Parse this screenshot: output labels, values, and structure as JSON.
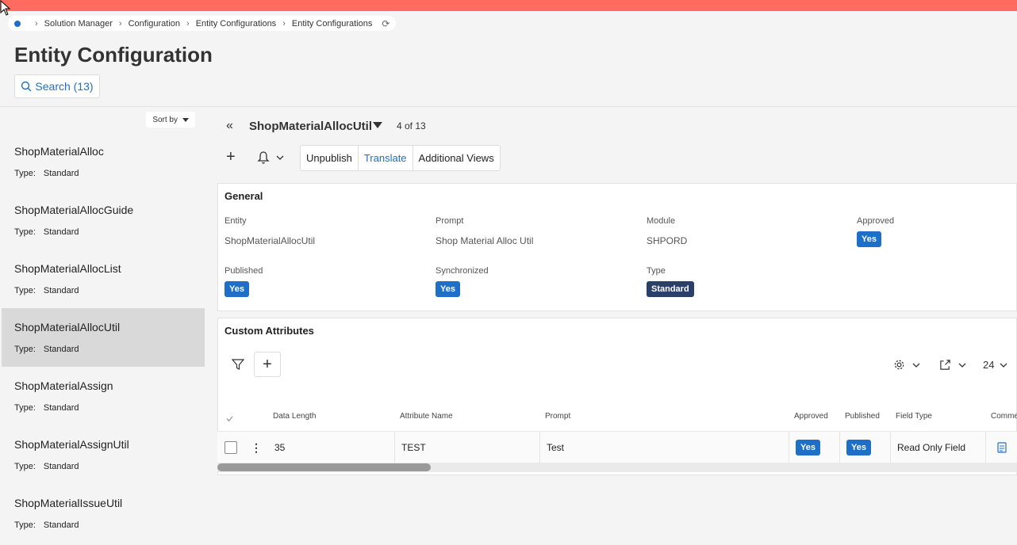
{
  "breadcrumb": {
    "items": [
      "Solution Manager",
      "Configuration",
      "Entity Configurations",
      "Entity Configurations"
    ]
  },
  "page": {
    "title": "Entity Configuration",
    "search_label": "Search (13)"
  },
  "sidebar": {
    "sort_label": "Sort by",
    "type_label": "Type:",
    "items": [
      {
        "name": "ShopMaterialAlloc",
        "type": "Standard"
      },
      {
        "name": "ShopMaterialAllocGuide",
        "type": "Standard"
      },
      {
        "name": "ShopMaterialAllocList",
        "type": "Standard"
      },
      {
        "name": "ShopMaterialAllocUtil",
        "type": "Standard"
      },
      {
        "name": "ShopMaterialAssign",
        "type": "Standard"
      },
      {
        "name": "ShopMaterialAssignUtil",
        "type": "Standard"
      },
      {
        "name": "ShopMaterialIssueUtil",
        "type": "Standard"
      }
    ]
  },
  "record": {
    "title": "ShopMaterialAllocUtil",
    "count": "4 of 13"
  },
  "toolbar": {
    "unpublish": "Unpublish",
    "translate": "Translate",
    "additional_views": "Additional Views"
  },
  "general": {
    "title": "General",
    "entity_label": "Entity",
    "entity_value": "ShopMaterialAllocUtil",
    "prompt_label": "Prompt",
    "prompt_value": "Shop Material Alloc Util",
    "module_label": "Module",
    "module_value": "SHPORD",
    "approved_label": "Approved",
    "approved_value": "Yes",
    "published_label": "Published",
    "published_value": "Yes",
    "synchronized_label": "Synchronized",
    "synchronized_value": "Yes",
    "type_label": "Type",
    "type_value": "Standard"
  },
  "custom_attributes": {
    "title": "Custom Attributes",
    "page_size": "24",
    "columns": [
      "Data Length",
      "Attribute Name",
      "Prompt",
      "Approved",
      "Published",
      "Field Type",
      "Comme"
    ],
    "rows": [
      {
        "data_length": "35",
        "attribute_name": "TEST",
        "prompt": "Test",
        "approved": "Yes",
        "published": "Yes",
        "field_type": "Read Only Field"
      }
    ]
  },
  "colors": {
    "topbar": "#ff6b5e",
    "accent": "#1d6fc7",
    "badge_navy": "#2b3f6b"
  }
}
